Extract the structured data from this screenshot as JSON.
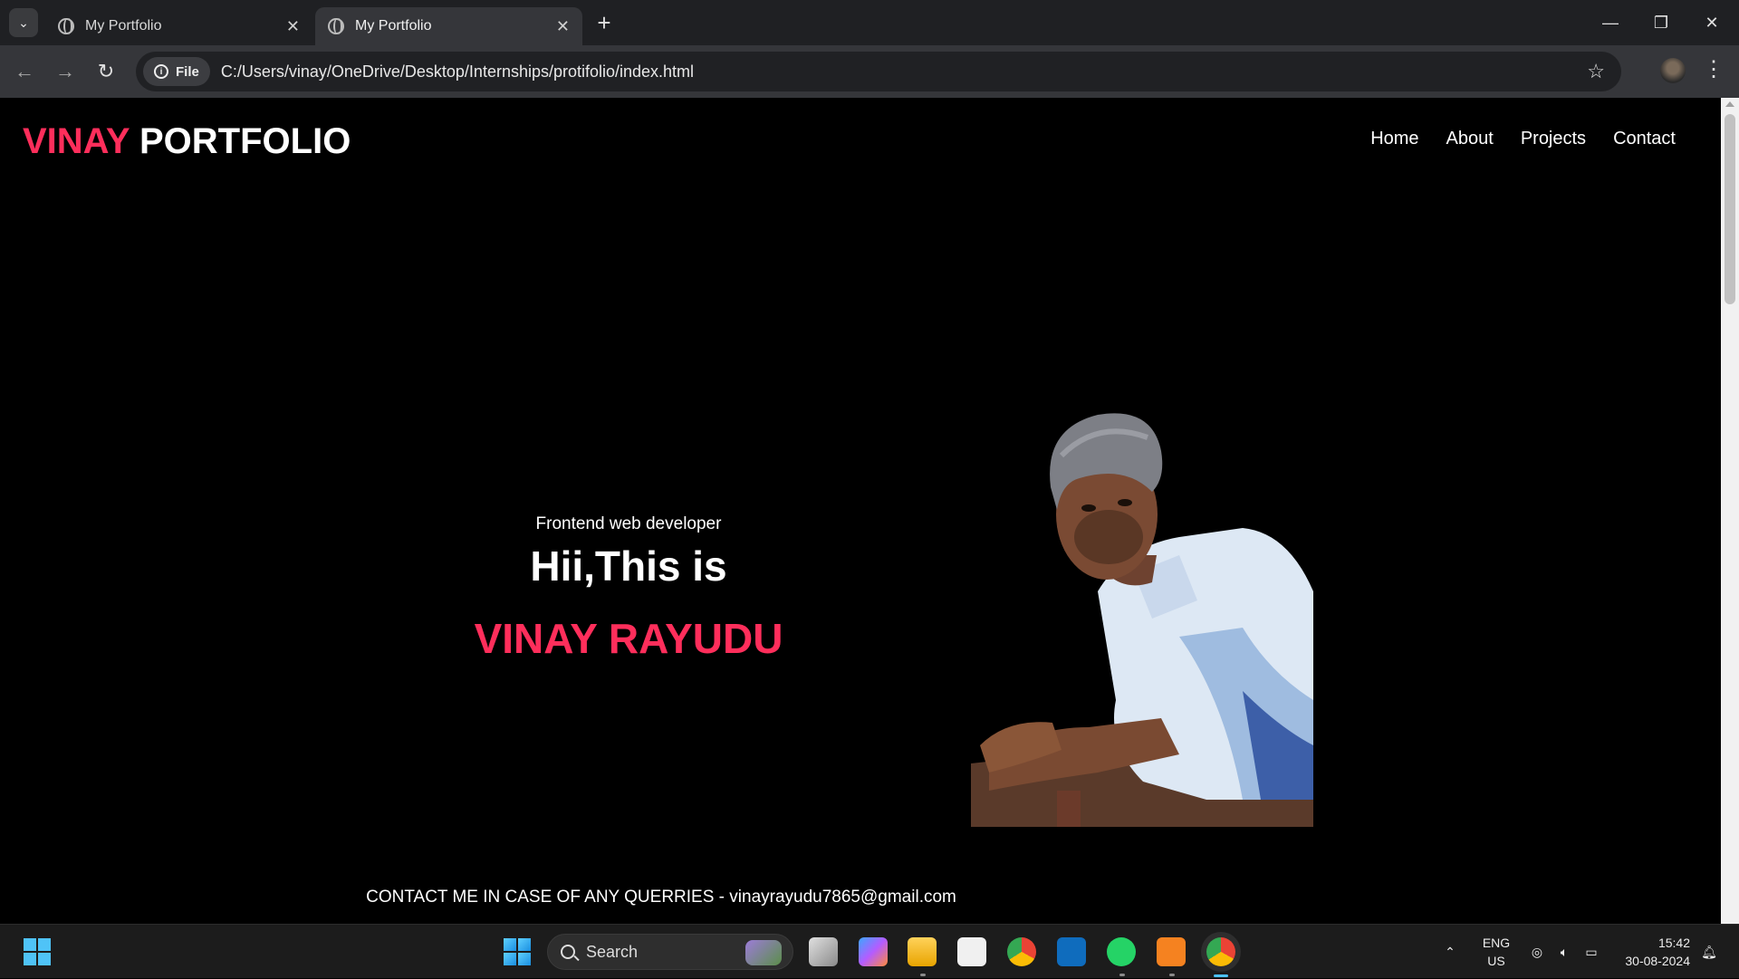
{
  "browser": {
    "tabs": [
      {
        "title": "My Portfolio",
        "active": false
      },
      {
        "title": "My Portfolio",
        "active": true
      }
    ],
    "new_tab_label": "+",
    "site_chip": "File",
    "url": "C:/Users/vinay/OneDrive/Desktop/Internships/protifolio/index.html"
  },
  "page": {
    "logo_accent": "VINAY",
    "logo_rest": "PORTFOLIO",
    "nav": [
      "Home",
      "About",
      "Projects",
      "Contact"
    ],
    "hero": {
      "subtitle": "Frontend web developer",
      "greeting": "Hii,This is",
      "name": "VINAY RAYUDU"
    },
    "footer": "CONTACT ME IN CASE OF ANY QUERRIES - vinayrayudu7865@gmail.com",
    "accent_color": "#ff2e5b"
  },
  "taskbar": {
    "search_label": "Search",
    "language": "ENG",
    "region": "US",
    "time": "15:42",
    "date": "30-08-2024"
  }
}
